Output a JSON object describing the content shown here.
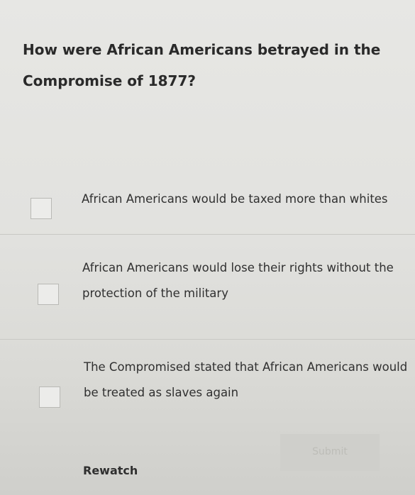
{
  "question": {
    "text": "How were African Americans betrayed in the Compromise of 1877?"
  },
  "options": [
    {
      "label": "African Americans would be taxed more than whites",
      "checked": false
    },
    {
      "label": "African Americans would lose their rights without the protection of the military",
      "checked": false
    },
    {
      "label": "The Compromised stated that African Americans would be treated as slaves again",
      "checked": false
    }
  ],
  "actions": {
    "submit_label": "Submit",
    "rewatch_label": "Rewatch"
  }
}
